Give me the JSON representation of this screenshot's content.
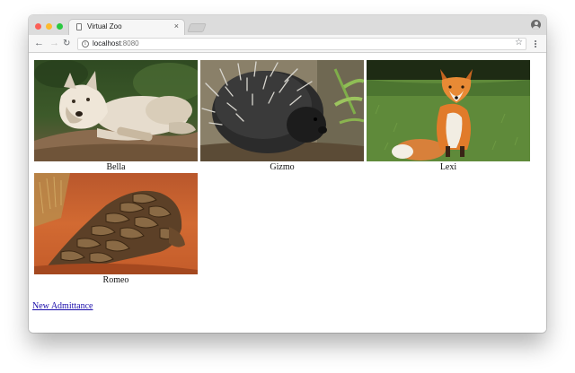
{
  "browser": {
    "tab_title": "Virtual Zoo",
    "tab_close": "×",
    "url_host": "localhost",
    "url_port": ":8080"
  },
  "animals": [
    {
      "name": "Bella",
      "image": "white-wolf-photo"
    },
    {
      "name": "Gizmo",
      "image": "porcupine-photo"
    },
    {
      "name": "Lexi",
      "image": "red-fox-photo"
    },
    {
      "name": "Romeo",
      "image": "pangolin-photo"
    }
  ],
  "links": {
    "new_admittance": "New Admittance"
  },
  "colors": {
    "link": "#1a0dab",
    "close": "#fc5f57",
    "minimize": "#fdbb2e",
    "maximize": "#29c840"
  }
}
